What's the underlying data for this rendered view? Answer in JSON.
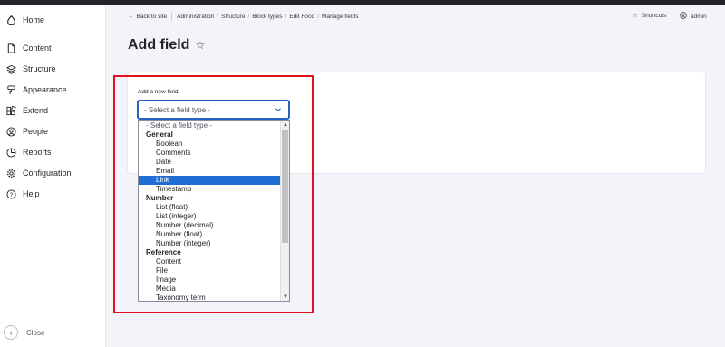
{
  "sidebar": {
    "home": "Home",
    "items": [
      {
        "label": "Content",
        "icon": "document-icon"
      },
      {
        "label": "Structure",
        "icon": "layers-icon"
      },
      {
        "label": "Appearance",
        "icon": "paint-roller-icon"
      },
      {
        "label": "Extend",
        "icon": "puzzle-icon"
      },
      {
        "label": "People",
        "icon": "user-circle-icon"
      },
      {
        "label": "Reports",
        "icon": "pie-chart-icon"
      },
      {
        "label": "Configuration",
        "icon": "gear-icon"
      },
      {
        "label": "Help",
        "icon": "help-icon"
      }
    ],
    "close_label": "Close"
  },
  "breadcrumb": {
    "back": "Back to site",
    "items": [
      "Administration",
      "Structure",
      "Block types",
      "Edit ",
      "Manage fields"
    ],
    "edit_emphasis": "Food"
  },
  "header": {
    "shortcuts": "Shortcuts",
    "user": "admin"
  },
  "page": {
    "title": "Add field"
  },
  "form": {
    "label": "Add a new field",
    "select_value": "- Select a field type -"
  },
  "dropdown": {
    "placeholder": "- Select a field type -",
    "groups": [
      {
        "label": "General",
        "options": [
          "Boolean",
          "Comments",
          "Date",
          "Email",
          "Link",
          "Timestamp"
        ]
      },
      {
        "label": "Number",
        "options": [
          "List (float)",
          "List (integer)",
          "Number (decimal)",
          "Number (float)",
          "Number (integer)"
        ]
      },
      {
        "label": "Reference",
        "options": [
          "Content",
          "File",
          "Image",
          "Media",
          "Taxonomy term"
        ]
      }
    ],
    "highlighted": "Link"
  },
  "colors": {
    "accent": "#2762c1",
    "highlight": "#1f6ed4",
    "annotation": "#e0131c"
  }
}
